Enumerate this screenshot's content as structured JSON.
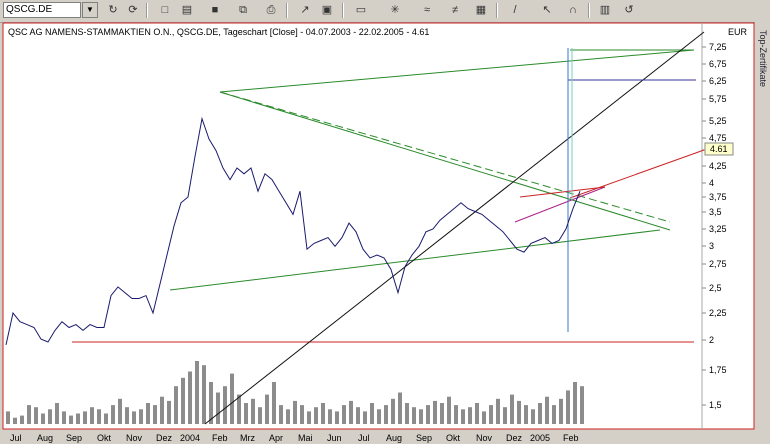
{
  "toolbar": {
    "symbol": "QSCG.DE",
    "buttons": [
      "refresh-icon",
      "new-icon",
      "open-icon",
      "save-icon",
      "copy-icon",
      "print-icon",
      "chart-type-icon",
      "indicator-icon",
      "zoom-icon",
      "draw-line-icon",
      "pointer-icon",
      "magnet-icon",
      "template-icon",
      "undo-icon"
    ]
  },
  "side_tab": {
    "label": "Top-Zertifikate"
  },
  "chart_data": {
    "type": "line",
    "title": "QSC AG NAMENS-STAMMAKTIEN O.N., QSCG.DE, Tageschart [Close] - 04.07.2003 - 22.02.2005 - 4.61",
    "currency": "EUR",
    "last_price": "4.61",
    "y_ticks": [
      "7,25",
      "6,75",
      "6,25",
      "5,75",
      "5,25",
      "4,75",
      "4,5",
      "4,25",
      "4",
      "3,75",
      "3,5",
      "3,25",
      "3",
      "2,75",
      "2,5",
      "2,25",
      "2",
      "1,75",
      "1,5"
    ],
    "x_labels": [
      "Jul",
      "Aug",
      "Sep",
      "Okt",
      "Nov",
      "Dez",
      "2004",
      "Feb",
      "Mrz",
      "Apr",
      "Mai",
      "Jun",
      "Jul",
      "Aug",
      "Sep",
      "Okt",
      "Nov",
      "Dez",
      "2005",
      "Feb"
    ],
    "x": [
      0,
      1,
      2,
      3,
      4,
      5,
      6,
      7,
      8,
      9,
      10,
      11,
      12,
      13,
      14,
      15,
      16,
      17,
      18,
      19,
      20,
      21,
      22,
      23,
      24,
      25,
      26,
      27,
      28,
      29,
      30,
      31,
      32,
      33,
      34,
      35,
      36,
      37,
      38,
      39,
      40,
      41,
      42,
      43,
      44,
      45,
      46,
      47,
      48,
      49,
      50,
      51,
      52,
      53,
      54,
      55,
      56,
      57,
      58,
      59,
      60,
      61,
      62,
      63,
      64,
      65,
      66,
      67,
      68,
      69,
      70,
      71,
      72,
      73,
      74,
      75,
      76,
      77,
      78,
      79,
      80,
      81,
      82
    ],
    "series": [
      {
        "values": [
          1.95,
          2.5,
          2.35,
          2.3,
          2.25,
          2.05,
          2.0,
          2.2,
          2.35,
          2.25,
          2.3,
          2.2,
          2.3,
          2.25,
          2.25,
          2.8,
          2.95,
          2.85,
          2.75,
          2.75,
          2.8,
          2.5,
          3.0,
          3.5,
          4.0,
          4.4,
          4.5,
          5.2,
          5.85,
          5.5,
          5.3,
          5.0,
          4.8,
          5.0,
          4.9,
          5.0,
          4.6,
          4.9,
          4.8,
          4.6,
          4.4,
          4.2,
          4.6,
          3.6,
          3.7,
          3.75,
          3.8,
          3.65,
          3.8,
          4.05,
          3.9,
          3.6,
          3.45,
          3.5,
          3.45,
          3.25,
          2.85,
          3.3,
          3.5,
          3.65,
          3.9,
          3.95,
          4.1,
          4.2,
          4.3,
          4.4,
          4.3,
          4.25,
          4.2,
          4.1,
          4.0,
          3.9,
          3.75,
          3.6,
          3.55,
          3.7,
          3.75,
          3.8,
          3.7,
          3.75,
          3.95,
          4.3,
          4.6
        ]
      }
    ],
    "volume": [
      6,
      3,
      4,
      9,
      8,
      5,
      7,
      10,
      6,
      4,
      5,
      6,
      8,
      7,
      5,
      9,
      12,
      8,
      6,
      7,
      10,
      9,
      13,
      11,
      18,
      22,
      25,
      30,
      28,
      20,
      15,
      18,
      24,
      14,
      10,
      12,
      8,
      14,
      20,
      9,
      7,
      11,
      9,
      6,
      8,
      10,
      7,
      6,
      9,
      11,
      8,
      6,
      10,
      7,
      9,
      12,
      15,
      10,
      8,
      7,
      9,
      11,
      10,
      13,
      9,
      7,
      8,
      10,
      6,
      9,
      12,
      8,
      14,
      11,
      9,
      7,
      10,
      13,
      9,
      12,
      16,
      20,
      18
    ]
  }
}
